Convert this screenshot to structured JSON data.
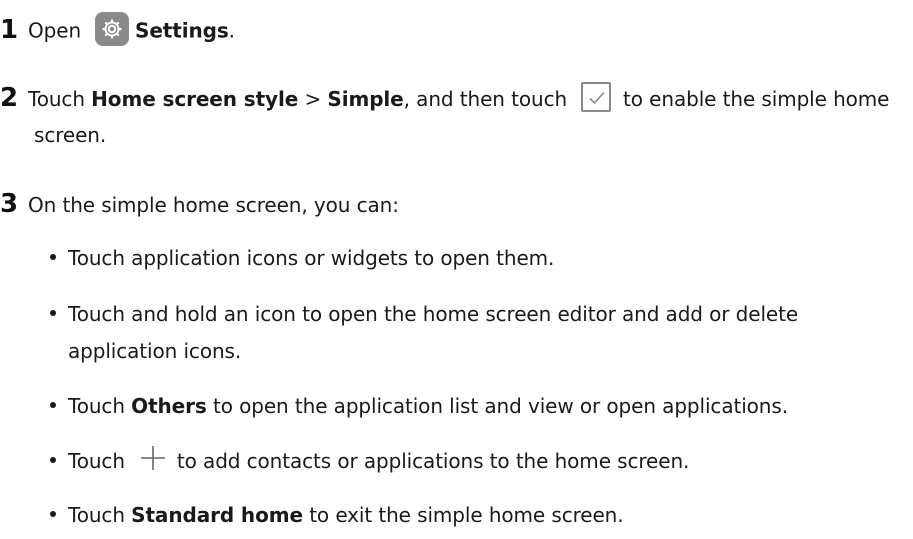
{
  "steps": [
    {
      "number": "1",
      "pre": "Open",
      "bold": "Settings",
      "post": "."
    },
    {
      "number": "2",
      "pre": "Touch",
      "bold1": "Home screen style",
      "sep": ">",
      "bold2": "Simple",
      "mid": ", and then touch",
      "post": "to enable the simple home",
      "cont": "screen."
    },
    {
      "number": "3",
      "text": "On the simple home screen, you can:"
    }
  ],
  "bullets": [
    {
      "text": "Touch application icons or widgets to open them."
    },
    {
      "text": "Touch and hold an icon to open the home screen editor and add or delete",
      "cont": "application icons."
    },
    {
      "pre": "Touch",
      "bold": "Others",
      "post": "to open the application list and view or open applications."
    },
    {
      "pre": "Touch",
      "post": "to add contacts or applications to the home screen."
    },
    {
      "pre": "Touch",
      "bold": "Standard home",
      "post": "to exit the simple home screen."
    }
  ],
  "icons": {
    "settings": "gear-icon",
    "check": "checkbox-icon",
    "add": "plus-icon"
  }
}
